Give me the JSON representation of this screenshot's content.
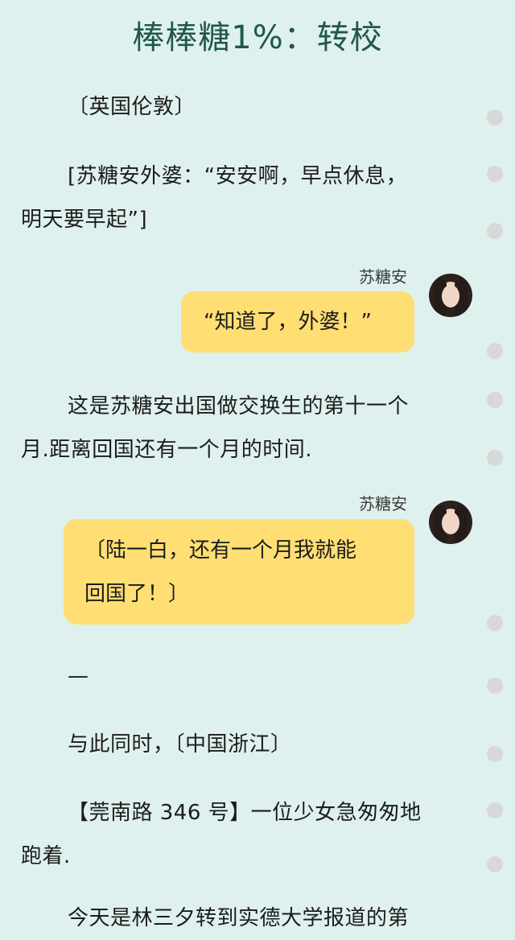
{
  "title": "棒棒糖1%：转校",
  "paragraphs": {
    "p1": {
      "line1": "〔英国伦敦〕"
    },
    "p2": {
      "line1": "[苏糖安外婆：“安安啊，早点休息，",
      "line2": "明天要早起”]"
    },
    "p3": {
      "line1": "这是苏糖安出国做交换生的第十一个",
      "line2": "月.距离回国还有一个月的时间."
    },
    "p4": {
      "line1": "—"
    },
    "p5": {
      "line1": "与此同时，〔中国浙江〕"
    },
    "p6": {
      "line1": "【莞南路 346 号】一位少女急匆匆地",
      "line2": "跑着."
    },
    "p7": {
      "line1": "今天是林三夕转到实德大学报道的第"
    }
  },
  "messages": [
    {
      "sender": "苏糖安",
      "avatar": "girl-avatar-icon",
      "lines": [
        "“知道了，外婆！”"
      ]
    },
    {
      "sender": "苏糖安",
      "avatar": "girl-avatar-icon",
      "lines": [
        "〔陆一白，还有一个月我就能",
        "回国了！〕"
      ]
    }
  ],
  "colors": {
    "background": "#dff1ee",
    "title": "#21574d",
    "bubble": "#ffdf73",
    "dot": "#d8d8d8"
  }
}
